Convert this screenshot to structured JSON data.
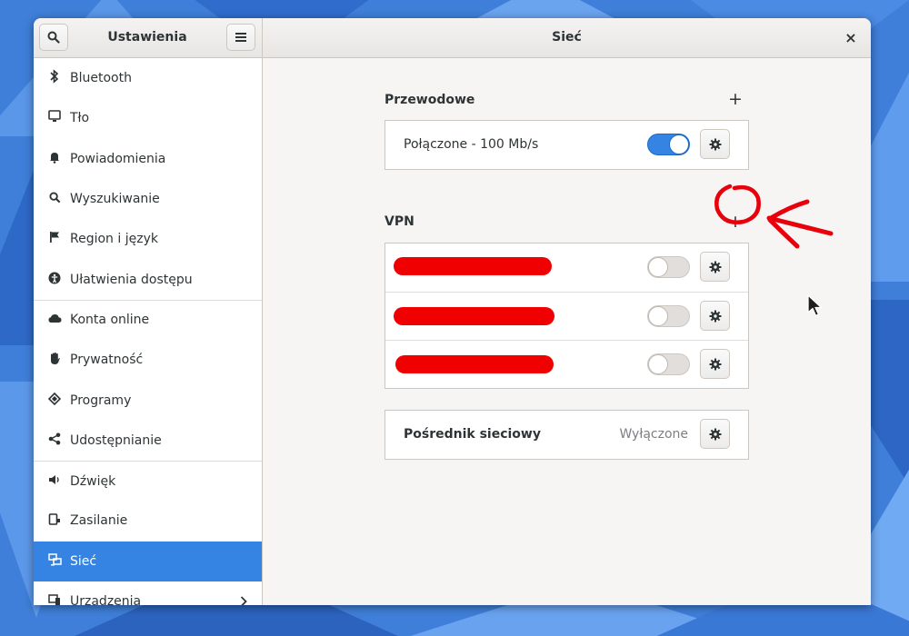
{
  "header": {
    "search_icon": "search-icon",
    "app_title": "Ustawienia",
    "menu_icon": "hamburger-menu-icon",
    "page_title": "Sieć",
    "close_glyph": "×"
  },
  "sidebar": {
    "items": [
      {
        "label": "Bluetooth",
        "icon": "bluetooth-icon"
      },
      {
        "label": "Tło",
        "icon": "monitor-icon"
      },
      {
        "label": "Powiadomienia",
        "icon": "bell-icon"
      },
      {
        "label": "Wyszukiwanie",
        "icon": "search-icon"
      },
      {
        "label": "Region i język",
        "icon": "flag-icon"
      },
      {
        "label": "Ułatwienia dostępu",
        "icon": "accessibility-icon"
      },
      {
        "label": "Konta online",
        "icon": "cloud-icon"
      },
      {
        "label": "Prywatność",
        "icon": "hand-icon"
      },
      {
        "label": "Programy",
        "icon": "apps-icon"
      },
      {
        "label": "Udostępnianie",
        "icon": "share-icon"
      },
      {
        "label": "Dźwięk",
        "icon": "speaker-icon"
      },
      {
        "label": "Zasilanie",
        "icon": "power-icon"
      },
      {
        "label": "Sieć",
        "icon": "network-icon",
        "active": true
      },
      {
        "label": "Urządzenia",
        "icon": "devices-icon"
      }
    ]
  },
  "wired": {
    "title": "Przewodowe",
    "add_glyph": "+",
    "connection_label": "Połączone - 100 Mb/s",
    "enabled": true
  },
  "vpn": {
    "title": "VPN",
    "add_glyph": "+",
    "connections": [
      {
        "enabled": false
      },
      {
        "enabled": false
      },
      {
        "enabled": false
      }
    ]
  },
  "proxy": {
    "label": "Pośrednik sieciowy",
    "status": "Wyłączone"
  },
  "colors": {
    "accent": "#3584e4",
    "redaction": "#f00000",
    "annotation": "#e8000b"
  }
}
